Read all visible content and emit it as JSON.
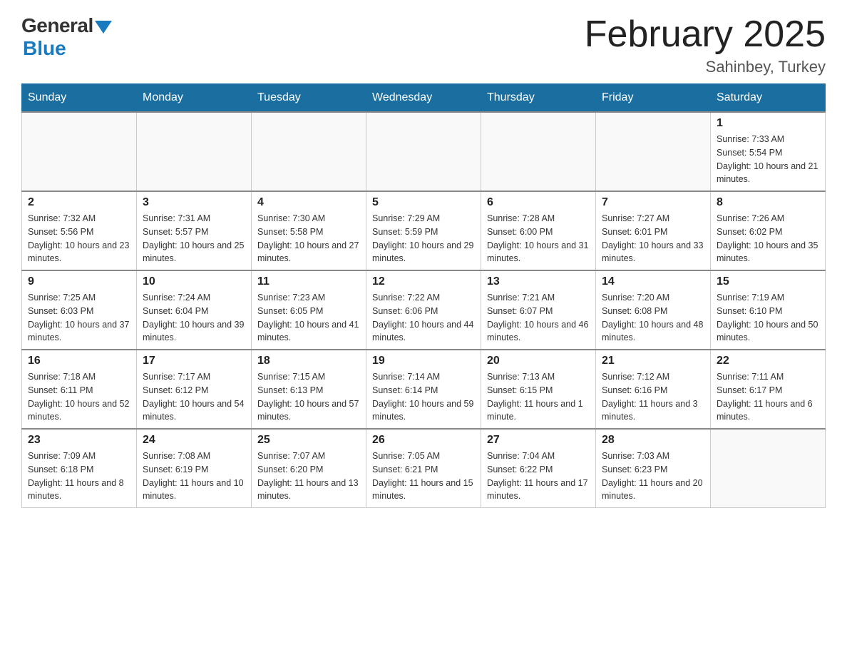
{
  "logo": {
    "general": "General",
    "blue": "Blue"
  },
  "title": "February 2025",
  "location": "Sahinbey, Turkey",
  "days_of_week": [
    "Sunday",
    "Monday",
    "Tuesday",
    "Wednesday",
    "Thursday",
    "Friday",
    "Saturday"
  ],
  "weeks": [
    [
      {
        "day": "",
        "info": ""
      },
      {
        "day": "",
        "info": ""
      },
      {
        "day": "",
        "info": ""
      },
      {
        "day": "",
        "info": ""
      },
      {
        "day": "",
        "info": ""
      },
      {
        "day": "",
        "info": ""
      },
      {
        "day": "1",
        "info": "Sunrise: 7:33 AM\nSunset: 5:54 PM\nDaylight: 10 hours and 21 minutes."
      }
    ],
    [
      {
        "day": "2",
        "info": "Sunrise: 7:32 AM\nSunset: 5:56 PM\nDaylight: 10 hours and 23 minutes."
      },
      {
        "day": "3",
        "info": "Sunrise: 7:31 AM\nSunset: 5:57 PM\nDaylight: 10 hours and 25 minutes."
      },
      {
        "day": "4",
        "info": "Sunrise: 7:30 AM\nSunset: 5:58 PM\nDaylight: 10 hours and 27 minutes."
      },
      {
        "day": "5",
        "info": "Sunrise: 7:29 AM\nSunset: 5:59 PM\nDaylight: 10 hours and 29 minutes."
      },
      {
        "day": "6",
        "info": "Sunrise: 7:28 AM\nSunset: 6:00 PM\nDaylight: 10 hours and 31 minutes."
      },
      {
        "day": "7",
        "info": "Sunrise: 7:27 AM\nSunset: 6:01 PM\nDaylight: 10 hours and 33 minutes."
      },
      {
        "day": "8",
        "info": "Sunrise: 7:26 AM\nSunset: 6:02 PM\nDaylight: 10 hours and 35 minutes."
      }
    ],
    [
      {
        "day": "9",
        "info": "Sunrise: 7:25 AM\nSunset: 6:03 PM\nDaylight: 10 hours and 37 minutes."
      },
      {
        "day": "10",
        "info": "Sunrise: 7:24 AM\nSunset: 6:04 PM\nDaylight: 10 hours and 39 minutes."
      },
      {
        "day": "11",
        "info": "Sunrise: 7:23 AM\nSunset: 6:05 PM\nDaylight: 10 hours and 41 minutes."
      },
      {
        "day": "12",
        "info": "Sunrise: 7:22 AM\nSunset: 6:06 PM\nDaylight: 10 hours and 44 minutes."
      },
      {
        "day": "13",
        "info": "Sunrise: 7:21 AM\nSunset: 6:07 PM\nDaylight: 10 hours and 46 minutes."
      },
      {
        "day": "14",
        "info": "Sunrise: 7:20 AM\nSunset: 6:08 PM\nDaylight: 10 hours and 48 minutes."
      },
      {
        "day": "15",
        "info": "Sunrise: 7:19 AM\nSunset: 6:10 PM\nDaylight: 10 hours and 50 minutes."
      }
    ],
    [
      {
        "day": "16",
        "info": "Sunrise: 7:18 AM\nSunset: 6:11 PM\nDaylight: 10 hours and 52 minutes."
      },
      {
        "day": "17",
        "info": "Sunrise: 7:17 AM\nSunset: 6:12 PM\nDaylight: 10 hours and 54 minutes."
      },
      {
        "day": "18",
        "info": "Sunrise: 7:15 AM\nSunset: 6:13 PM\nDaylight: 10 hours and 57 minutes."
      },
      {
        "day": "19",
        "info": "Sunrise: 7:14 AM\nSunset: 6:14 PM\nDaylight: 10 hours and 59 minutes."
      },
      {
        "day": "20",
        "info": "Sunrise: 7:13 AM\nSunset: 6:15 PM\nDaylight: 11 hours and 1 minute."
      },
      {
        "day": "21",
        "info": "Sunrise: 7:12 AM\nSunset: 6:16 PM\nDaylight: 11 hours and 3 minutes."
      },
      {
        "day": "22",
        "info": "Sunrise: 7:11 AM\nSunset: 6:17 PM\nDaylight: 11 hours and 6 minutes."
      }
    ],
    [
      {
        "day": "23",
        "info": "Sunrise: 7:09 AM\nSunset: 6:18 PM\nDaylight: 11 hours and 8 minutes."
      },
      {
        "day": "24",
        "info": "Sunrise: 7:08 AM\nSunset: 6:19 PM\nDaylight: 11 hours and 10 minutes."
      },
      {
        "day": "25",
        "info": "Sunrise: 7:07 AM\nSunset: 6:20 PM\nDaylight: 11 hours and 13 minutes."
      },
      {
        "day": "26",
        "info": "Sunrise: 7:05 AM\nSunset: 6:21 PM\nDaylight: 11 hours and 15 minutes."
      },
      {
        "day": "27",
        "info": "Sunrise: 7:04 AM\nSunset: 6:22 PM\nDaylight: 11 hours and 17 minutes."
      },
      {
        "day": "28",
        "info": "Sunrise: 7:03 AM\nSunset: 6:23 PM\nDaylight: 11 hours and 20 minutes."
      },
      {
        "day": "",
        "info": ""
      }
    ]
  ]
}
